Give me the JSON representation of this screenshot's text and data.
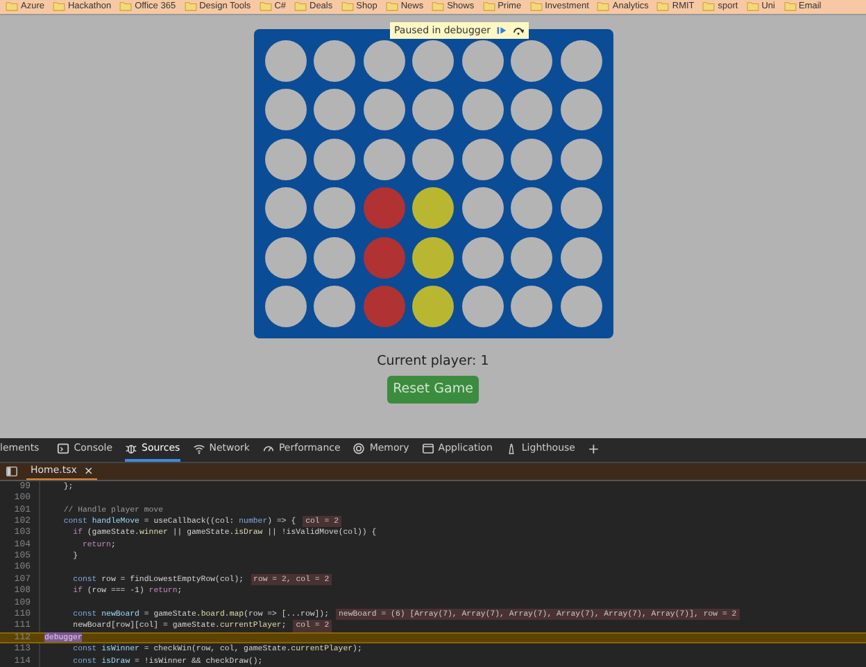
{
  "bookmarks": [
    "Azure",
    "Hackathon",
    "Office 365",
    "Design Tools",
    "C#",
    "Deals",
    "Shop",
    "News",
    "Shows",
    "Prime",
    "Investment",
    "Analytics",
    "RMIT",
    "sport",
    "Uni",
    "Email"
  ],
  "debugger_banner": {
    "text": "Paused in debugger"
  },
  "board": [
    [
      {
        "kind": "empty"
      },
      {
        "kind": "empty"
      },
      {
        "kind": "empty"
      },
      {
        "kind": "empty"
      },
      {
        "kind": "empty"
      },
      {
        "kind": "empty"
      },
      {
        "kind": "empty"
      }
    ],
    [
      {
        "kind": "empty"
      },
      {
        "kind": "empty"
      },
      {
        "kind": "empty"
      },
      {
        "kind": "empty"
      },
      {
        "kind": "empty"
      },
      {
        "kind": "empty"
      },
      {
        "kind": "empty"
      }
    ],
    [
      {
        "kind": "empty"
      },
      {
        "kind": "empty"
      },
      {
        "kind": "empty"
      },
      {
        "kind": "empty"
      },
      {
        "kind": "empty"
      },
      {
        "kind": "empty"
      },
      {
        "kind": "empty"
      }
    ],
    [
      {
        "kind": "empty"
      },
      {
        "kind": "empty"
      },
      {
        "kind": "red"
      },
      {
        "kind": "yellow"
      },
      {
        "kind": "empty"
      },
      {
        "kind": "empty"
      },
      {
        "kind": "empty"
      }
    ],
    [
      {
        "kind": "empty"
      },
      {
        "kind": "empty"
      },
      {
        "kind": "red"
      },
      {
        "kind": "yellow"
      },
      {
        "kind": "empty"
      },
      {
        "kind": "empty"
      },
      {
        "kind": "empty"
      }
    ],
    [
      {
        "kind": "empty"
      },
      {
        "kind": "empty"
      },
      {
        "kind": "red"
      },
      {
        "kind": "yellow"
      },
      {
        "kind": "empty"
      },
      {
        "kind": "empty"
      },
      {
        "kind": "empty"
      }
    ]
  ],
  "status": "Current player: 1",
  "reset_button": "Reset Game",
  "devtools": {
    "tabs": [
      {
        "label": "lements",
        "selected": false
      },
      {
        "label": "Console",
        "selected": false
      },
      {
        "label": "Sources",
        "selected": true
      },
      {
        "label": "Network",
        "selected": false
      },
      {
        "label": "Performance",
        "selected": false
      },
      {
        "label": "Memory",
        "selected": false
      },
      {
        "label": "Application",
        "selected": false
      },
      {
        "label": "Lighthouse",
        "selected": false
      }
    ],
    "add_tab": "+",
    "file_tab": {
      "name": "Home.tsx",
      "close": "×"
    },
    "lines": [
      {
        "number": "99",
        "paused": false,
        "segments": [
          {
            "text": "  };",
            "kind": "plain"
          }
        ]
      },
      {
        "number": "100",
        "paused": false
      },
      {
        "number": "101",
        "paused": false,
        "segments": [
          {
            "text": "  // Handle player move",
            "kind": "comment"
          }
        ]
      },
      {
        "number": "102",
        "paused": false,
        "segments": [
          {
            "text": "  const ",
            "kind": "keyword"
          },
          {
            "text": "handleMove",
            "kind": "variable"
          },
          {
            "text": " = useCallback((col: ",
            "kind": "plain"
          },
          {
            "text": "number",
            "kind": "keyword"
          },
          {
            "text": ") => {",
            "kind": "plain"
          }
        ],
        "inline_value": "col = 2"
      },
      {
        "number": "103",
        "paused": false,
        "segments": [
          {
            "text": "    if",
            "kind": "control"
          },
          {
            "text": " (gameState.",
            "kind": "plain"
          },
          {
            "text": "winner",
            "kind": "property"
          },
          {
            "text": " || gameState.",
            "kind": "plain"
          },
          {
            "text": "isDraw",
            "kind": "property"
          },
          {
            "text": " || !isValidMove(col)) {",
            "kind": "plain"
          }
        ]
      },
      {
        "number": "104",
        "paused": false,
        "segments": [
          {
            "text": "      return",
            "kind": "control"
          },
          {
            "text": ";",
            "kind": "plain"
          }
        ]
      },
      {
        "number": "105",
        "paused": false,
        "segments": [
          {
            "text": "    }",
            "kind": "plain"
          }
        ]
      },
      {
        "number": "106",
        "paused": false
      },
      {
        "number": "107",
        "paused": false,
        "segments": [
          {
            "text": "    const",
            "kind": "keyword"
          },
          {
            "text": " row = findLowestEmptyRow(col);",
            "kind": "plain"
          }
        ],
        "inline_value": "row = 2, col = 2"
      },
      {
        "number": "108",
        "paused": false,
        "segments": [
          {
            "text": "    if",
            "kind": "control"
          },
          {
            "text": " (row === -1) ",
            "kind": "plain"
          },
          {
            "text": "return",
            "kind": "control"
          },
          {
            "text": ";",
            "kind": "plain"
          }
        ]
      },
      {
        "number": "109",
        "paused": false
      },
      {
        "number": "110",
        "paused": false,
        "segments": [
          {
            "text": "    const ",
            "kind": "keyword"
          },
          {
            "text": "newBoard",
            "kind": "variable"
          },
          {
            "text": " = gameState.",
            "kind": "plain"
          },
          {
            "text": "board",
            "kind": "property"
          },
          {
            "text": ".",
            "kind": "plain"
          },
          {
            "text": "map",
            "kind": "property"
          },
          {
            "text": "(row => [...row]);",
            "kind": "plain"
          }
        ],
        "inline_value": "newBoard = (6) [Array(7), Array(7), Array(7), Array(7), Array(7), Array(7)], row = 2"
      },
      {
        "number": "111",
        "paused": false,
        "segments": [
          {
            "text": "    newBoard[row][col] = gameState.",
            "kind": "plain"
          },
          {
            "text": "currentPlayer",
            "kind": "property"
          },
          {
            "text": ";",
            "kind": "plain"
          }
        ],
        "inline_value": "col = 2"
      },
      {
        "number": "112",
        "paused": true,
        "segments": [
          {
            "text": "debugger",
            "kind": "current"
          }
        ]
      },
      {
        "number": "113",
        "paused": false,
        "segments": [
          {
            "text": "    const ",
            "kind": "keyword"
          },
          {
            "text": "isWinner",
            "kind": "variable"
          },
          {
            "text": " = checkWin(row, col, gameState.",
            "kind": "plain"
          },
          {
            "text": "currentPlayer",
            "kind": "property"
          },
          {
            "text": ");",
            "kind": "plain"
          }
        ]
      },
      {
        "number": "114",
        "paused": false,
        "segments": [
          {
            "text": "    const ",
            "kind": "keyword"
          },
          {
            "text": "isDraw",
            "kind": "variable"
          },
          {
            "text": " = !isWinner && checkDraw();",
            "kind": "plain"
          }
        ]
      }
    ]
  }
}
